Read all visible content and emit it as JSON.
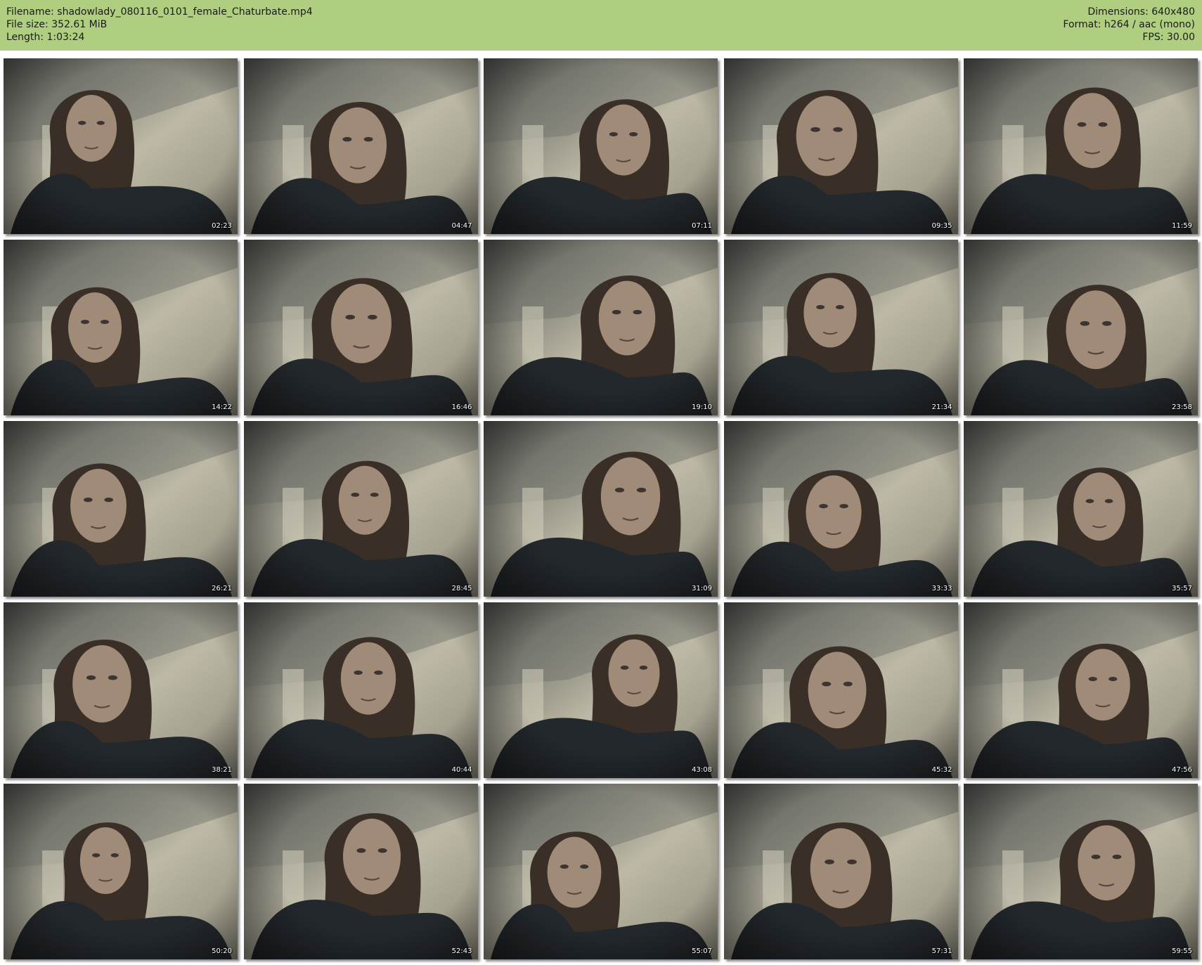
{
  "info": {
    "filename": "Filename: shadowlady_080116_0101_female_Chaturbate.mp4",
    "filesize": "File size: 352.61 MiB",
    "length": "Length: 1:03:24",
    "dimensions": "Dimensions: 640x480",
    "format": "Format: h264 / aac (mono)",
    "fps": "FPS: 30.00"
  },
  "colors": {
    "header_bg": "#b0ce7f",
    "page_bg": "#ffffff"
  },
  "thumbnails": [
    {
      "time": "02:23"
    },
    {
      "time": "04:47"
    },
    {
      "time": "07:11"
    },
    {
      "time": "09:35"
    },
    {
      "time": "11:59"
    },
    {
      "time": "14:22"
    },
    {
      "time": "16:46"
    },
    {
      "time": "19:10"
    },
    {
      "time": "21:34"
    },
    {
      "time": "23:58"
    },
    {
      "time": "26:21"
    },
    {
      "time": "28:45"
    },
    {
      "time": "31:09"
    },
    {
      "time": "33:33"
    },
    {
      "time": "35:57"
    },
    {
      "time": "38:21"
    },
    {
      "time": "40:44"
    },
    {
      "time": "43:08"
    },
    {
      "time": "45:32"
    },
    {
      "time": "47:56"
    },
    {
      "time": "50:20"
    },
    {
      "time": "52:43"
    },
    {
      "time": "55:07"
    },
    {
      "time": "57:31"
    },
    {
      "time": "59:55"
    }
  ]
}
